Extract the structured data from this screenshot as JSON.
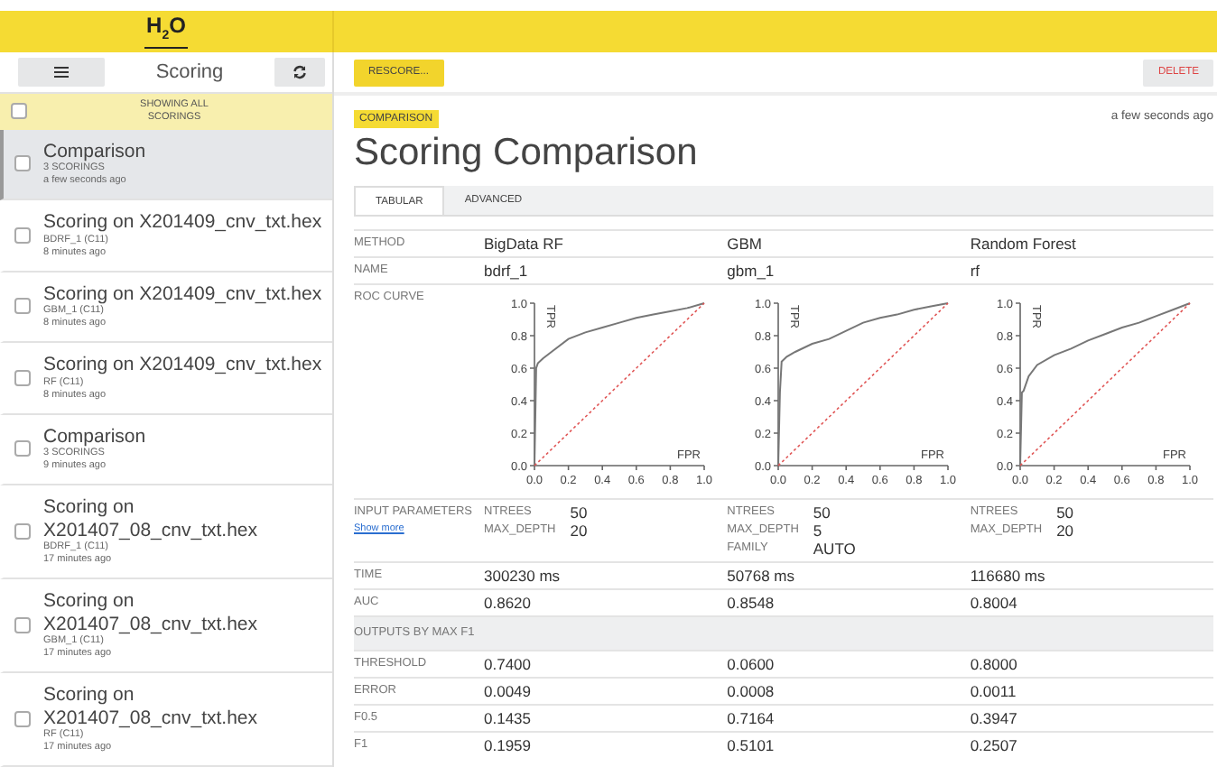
{
  "header": {
    "logo": "H$_{2}$O"
  },
  "sidebar": {
    "title": "Scoring",
    "filter_label": "SHOWING ALL SCORINGS",
    "filter_checked": false,
    "items": [
      {
        "title": "Comparison",
        "subtitle": "3 SCORINGS",
        "time": "a few seconds ago",
        "selected": true,
        "checked": false
      },
      {
        "title": "Scoring on X201409_cnv_txt.hex",
        "subtitle": "BDRF_1 (C11)",
        "time": "8 minutes ago",
        "selected": false,
        "checked": false
      },
      {
        "title": "Scoring on X201409_cnv_txt.hex",
        "subtitle": "GBM_1 (C11)",
        "time": "8 minutes ago",
        "selected": false,
        "checked": false
      },
      {
        "title": "Scoring on X201409_cnv_txt.hex",
        "subtitle": "RF (C11)",
        "time": "8 minutes ago",
        "selected": false,
        "checked": false
      },
      {
        "title": "Comparison",
        "subtitle": "3 SCORINGS",
        "time": "9 minutes ago",
        "selected": false,
        "checked": false
      },
      {
        "title": "Scoring on X201407_08_cnv_txt.hex",
        "subtitle": "BDRF_1 (C11)",
        "time": "17 minutes ago",
        "selected": false,
        "checked": false
      },
      {
        "title": "Scoring on X201407_08_cnv_txt.hex",
        "subtitle": "GBM_1 (C11)",
        "time": "17 minutes ago",
        "selected": false,
        "checked": false
      },
      {
        "title": "Scoring on X201407_08_cnv_txt.hex",
        "subtitle": "RF (C11)",
        "time": "17 minutes ago",
        "selected": false,
        "checked": false
      }
    ]
  },
  "main": {
    "buttons": [
      {
        "label": "RESCORE...",
        "kind": "primary"
      },
      {
        "label": "DELETE",
        "kind": "danger"
      }
    ],
    "badge": "COMPARISON",
    "timestamp": "a few seconds ago",
    "title": "Scoring Comparison",
    "tabs": [
      {
        "label": "TABULAR",
        "selected": true
      },
      {
        "label": "ADVANCED",
        "selected": false
      }
    ],
    "table": {
      "rows": [
        {
          "kind": "text",
          "label": "METHOD",
          "values": [
            "BigData RF",
            "GBM",
            "Random Forest"
          ]
        },
        {
          "kind": "text",
          "label": "NAME",
          "values": [
            "bdrf_1",
            "gbm_1",
            "rf"
          ]
        },
        {
          "kind": "roc",
          "label": "ROC CURVE",
          "charts": [
            {
              "chart_data": {
                "type": "line",
                "xlabel": "FPR",
                "ylabel": "TPR",
                "x": [
                  0,
                  0.01,
                  0.02,
                  0.05,
                  0.1,
                  0.2,
                  0.3,
                  0.4,
                  0.5,
                  0.6,
                  0.7,
                  0.8,
                  0.9,
                  1.0
                ],
                "series": [
                  {
                    "color": "#777777",
                    "line_style": "solid",
                    "values": [
                      0,
                      0.6,
                      0.63,
                      0.66,
                      0.7,
                      0.78,
                      0.82,
                      0.85,
                      0.88,
                      0.91,
                      0.93,
                      0.95,
                      0.97,
                      1.0
                    ]
                  },
                  {
                    "color": "#e05555",
                    "line_style": "dashed",
                    "values": [
                      0,
                      0.01,
                      0.02,
                      0.05,
                      0.1,
                      0.2,
                      0.3,
                      0.4,
                      0.5,
                      0.6,
                      0.7,
                      0.8,
                      0.9,
                      1.0
                    ]
                  }
                ],
                "xlim": [
                  0,
                  1
                ],
                "ylim": [
                  0,
                  1
                ],
                "xticks": [
                  {
                    "value": 0,
                    "label": "0.0"
                  },
                  {
                    "value": 0.2,
                    "label": "0.2"
                  },
                  {
                    "value": 0.4,
                    "label": "0.4"
                  },
                  {
                    "value": 0.6,
                    "label": "0.6"
                  },
                  {
                    "value": 0.8,
                    "label": "0.8"
                  },
                  {
                    "value": 1,
                    "label": "1.0"
                  }
                ],
                "yticks": [
                  {
                    "value": 0,
                    "label": "0.0"
                  },
                  {
                    "value": 0.2,
                    "label": "0.2"
                  },
                  {
                    "value": 0.4,
                    "label": "0.4"
                  },
                  {
                    "value": 0.6,
                    "label": "0.6"
                  },
                  {
                    "value": 0.8,
                    "label": "0.8"
                  },
                  {
                    "value": 1,
                    "label": "1.0"
                  }
                ]
              }
            },
            {
              "chart_data": {
                "type": "line",
                "xlabel": "FPR",
                "ylabel": "TPR",
                "x": [
                  0,
                  0.01,
                  0.02,
                  0.05,
                  0.1,
                  0.2,
                  0.3,
                  0.4,
                  0.5,
                  0.6,
                  0.7,
                  0.8,
                  0.9,
                  1.0
                ],
                "series": [
                  {
                    "color": "#777777",
                    "line_style": "solid",
                    "values": [
                      0,
                      0.45,
                      0.64,
                      0.67,
                      0.7,
                      0.75,
                      0.78,
                      0.83,
                      0.88,
                      0.91,
                      0.93,
                      0.96,
                      0.98,
                      1.0
                    ]
                  },
                  {
                    "color": "#e05555",
                    "line_style": "dashed",
                    "values": [
                      0,
                      0.01,
                      0.02,
                      0.05,
                      0.1,
                      0.2,
                      0.3,
                      0.4,
                      0.5,
                      0.6,
                      0.7,
                      0.8,
                      0.9,
                      1.0
                    ]
                  }
                ],
                "xlim": [
                  0,
                  1
                ],
                "ylim": [
                  0,
                  1
                ],
                "xticks": [
                  {
                    "value": 0,
                    "label": "0.0"
                  },
                  {
                    "value": 0.2,
                    "label": "0.2"
                  },
                  {
                    "value": 0.4,
                    "label": "0.4"
                  },
                  {
                    "value": 0.6,
                    "label": "0.6"
                  },
                  {
                    "value": 0.8,
                    "label": "0.8"
                  },
                  {
                    "value": 1,
                    "label": "1.0"
                  }
                ],
                "yticks": [
                  {
                    "value": 0,
                    "label": "0.0"
                  },
                  {
                    "value": 0.2,
                    "label": "0.2"
                  },
                  {
                    "value": 0.4,
                    "label": "0.4"
                  },
                  {
                    "value": 0.6,
                    "label": "0.6"
                  },
                  {
                    "value": 0.8,
                    "label": "0.8"
                  },
                  {
                    "value": 1,
                    "label": "1.0"
                  }
                ]
              }
            },
            {
              "chart_data": {
                "type": "line",
                "xlabel": "FPR",
                "ylabel": "TPR",
                "x": [
                  0,
                  0.01,
                  0.02,
                  0.05,
                  0.1,
                  0.2,
                  0.3,
                  0.4,
                  0.5,
                  0.6,
                  0.7,
                  0.8,
                  0.9,
                  1.0
                ],
                "series": [
                  {
                    "color": "#777777",
                    "line_style": "solid",
                    "values": [
                      0,
                      0.45,
                      0.46,
                      0.55,
                      0.62,
                      0.68,
                      0.72,
                      0.77,
                      0.81,
                      0.85,
                      0.88,
                      0.92,
                      0.96,
                      1.0
                    ]
                  },
                  {
                    "color": "#e05555",
                    "line_style": "dashed",
                    "values": [
                      0,
                      0.01,
                      0.02,
                      0.05,
                      0.1,
                      0.2,
                      0.3,
                      0.4,
                      0.5,
                      0.6,
                      0.7,
                      0.8,
                      0.9,
                      1.0
                    ]
                  }
                ],
                "xlim": [
                  0,
                  1
                ],
                "ylim": [
                  0,
                  1
                ],
                "xticks": [
                  {
                    "value": 0,
                    "label": "0.0"
                  },
                  {
                    "value": 0.2,
                    "label": "0.2"
                  },
                  {
                    "value": 0.4,
                    "label": "0.4"
                  },
                  {
                    "value": 0.6,
                    "label": "0.6"
                  },
                  {
                    "value": 0.8,
                    "label": "0.8"
                  },
                  {
                    "value": 1,
                    "label": "1.0"
                  }
                ],
                "yticks": [
                  {
                    "value": 0,
                    "label": "0.0"
                  },
                  {
                    "value": 0.2,
                    "label": "0.2"
                  },
                  {
                    "value": 0.4,
                    "label": "0.4"
                  },
                  {
                    "value": 0.6,
                    "label": "0.6"
                  },
                  {
                    "value": 0.8,
                    "label": "0.8"
                  },
                  {
                    "value": 1,
                    "label": "1.0"
                  }
                ]
              }
            }
          ]
        },
        {
          "kind": "params",
          "label": "INPUT PARAMETERS",
          "link": "Show more",
          "params": [
            [
              {
                "name": "NTREES",
                "value": "50"
              },
              {
                "name": "MAX_DEPTH",
                "value": "20"
              }
            ],
            [
              {
                "name": "NTREES",
                "value": "50"
              },
              {
                "name": "MAX_DEPTH",
                "value": "5"
              },
              {
                "name": "FAMILY",
                "value": "AUTO"
              }
            ],
            [
              {
                "name": "NTREES",
                "value": "50"
              },
              {
                "name": "MAX_DEPTH",
                "value": "20"
              }
            ]
          ]
        },
        {
          "kind": "text",
          "label": "TIME",
          "values": [
            "300230 ms",
            "50768 ms",
            "116680 ms"
          ]
        },
        {
          "kind": "text",
          "label": "AUC",
          "values": [
            "0.8620",
            "0.8548",
            "0.8004"
          ]
        },
        {
          "kind": "section",
          "label": "OUTPUTS BY MAX F1"
        },
        {
          "kind": "text",
          "label": "THRESHOLD",
          "values": [
            "0.7400",
            "0.0600",
            "0.8000"
          ]
        },
        {
          "kind": "text",
          "label": "ERROR",
          "values": [
            "0.0049",
            "0.0008",
            "0.0011"
          ]
        },
        {
          "kind": "text",
          "label": "F0.5",
          "values": [
            "0.1435",
            "0.7164",
            "0.3947"
          ]
        },
        {
          "kind": "text",
          "label": "F1",
          "values": [
            "0.1959",
            "0.5101",
            "0.2507"
          ]
        }
      ]
    }
  }
}
